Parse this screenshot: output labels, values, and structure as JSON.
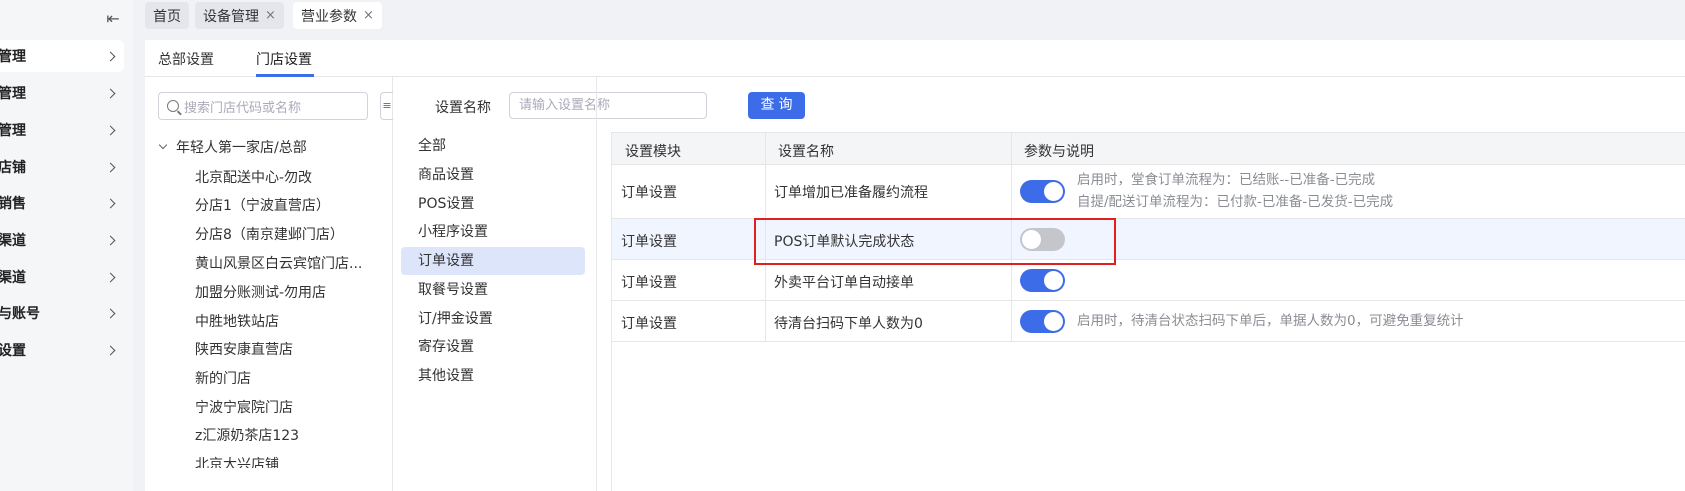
{
  "sidebar": {
    "collapse_icon": "collapse-left-icon",
    "items": [
      {
        "label": "管理"
      },
      {
        "label": "管理"
      },
      {
        "label": "管理"
      },
      {
        "label": "店铺"
      },
      {
        "label": "销售"
      },
      {
        "label": "渠道"
      },
      {
        "label": "渠道"
      },
      {
        "label": "与账号"
      },
      {
        "label": "设置"
      }
    ]
  },
  "tabs": [
    {
      "label": "首页"
    },
    {
      "label": "设备管理",
      "close": "×"
    },
    {
      "label": "营业参数",
      "close": "×"
    }
  ],
  "subtabs": [
    {
      "label": "总部设置"
    },
    {
      "label": "门店设置"
    }
  ],
  "store_search": {
    "placeholder": "搜索门店代码或名称",
    "side_button": "≡"
  },
  "tree": {
    "root": "年轻人第一家店/总部",
    "nodes": [
      "北京配送中心-勿改",
      "分店1（宁波直营店）",
      "分店8（南京建邺门店）",
      "黄山风景区白云宾馆门店...",
      "加盟分账测试-勿用店",
      "中胜地铁站店",
      "陕西安康直营店",
      "新的门店",
      "宁波宁宸院门店",
      "z汇源奶茶店123",
      "北京大兴店铺"
    ]
  },
  "filter": {
    "label": "设置名称",
    "placeholder": "请输入设置名称",
    "query_button": "查询"
  },
  "categories": [
    "全部",
    "商品设置",
    "POS设置",
    "小程序设置",
    "订单设置",
    "取餐号设置",
    "订/押金设置",
    "寄存设置",
    "其他设置"
  ],
  "table": {
    "headers": [
      "设置模块",
      "设置名称",
      "参数与说明"
    ],
    "rows": [
      {
        "module": "订单设置",
        "name": "订单增加已准备履约流程",
        "enabled": true,
        "desc1": "启用时，堂食订单流程为：已结账--已准备-已完成",
        "desc2": "自提/配送订单流程为：已付款-已准备-已发货-已完成"
      },
      {
        "module": "订单设置",
        "name": "POS订单默认完成状态",
        "enabled": false,
        "desc1": "",
        "desc2": ""
      },
      {
        "module": "订单设置",
        "name": "外卖平台订单自动接单",
        "enabled": true,
        "desc1": "",
        "desc2": ""
      },
      {
        "module": "订单设置",
        "name": "待清台扫码下单人数为0",
        "enabled": true,
        "desc1": "启用时，待清台状态扫码下单后，单据人数为0，可避免重复统计",
        "desc2": ""
      }
    ]
  },
  "colors": {
    "accent": "#3d6ce8",
    "highlight_box": "#e02020",
    "active_category": "#dde5fb"
  }
}
